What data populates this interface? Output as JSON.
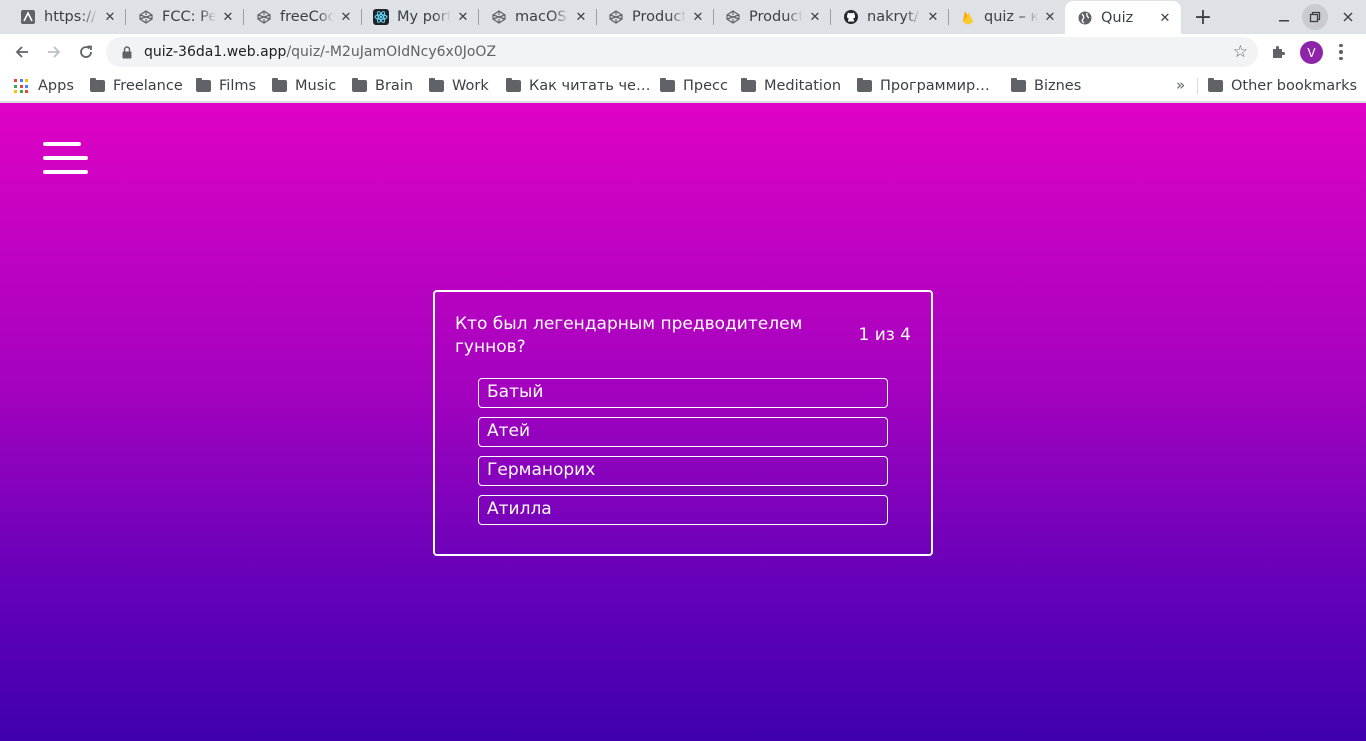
{
  "browser": {
    "tabs": [
      {
        "title": "https://",
        "icon": "generic-page-icon",
        "active": false
      },
      {
        "title": "FCC: Per",
        "icon": "codepen-icon",
        "active": false
      },
      {
        "title": "freeCoc",
        "icon": "codepen-icon",
        "active": false
      },
      {
        "title": "My port",
        "icon": "react-icon",
        "active": false
      },
      {
        "title": "macOS",
        "icon": "codepen-icon",
        "active": false
      },
      {
        "title": "Product",
        "icon": "codepen-icon",
        "active": false
      },
      {
        "title": "Product",
        "icon": "codepen-icon",
        "active": false
      },
      {
        "title": "nakryt/",
        "icon": "github-icon",
        "active": false
      },
      {
        "title": "quiz – ко",
        "icon": "firebase-icon",
        "active": false
      },
      {
        "title": "Quiz",
        "icon": "globe-icon",
        "active": true
      }
    ],
    "address": {
      "host": "quiz-36da1.web.app",
      "path": "/quiz/-M2uJamOIdNcy6x0JoOZ"
    },
    "profile_initial": "V",
    "bookmarks": [
      {
        "label": "Apps",
        "type": "apps"
      },
      {
        "label": "Freelance",
        "type": "folder"
      },
      {
        "label": "Films",
        "type": "folder"
      },
      {
        "label": "Music",
        "type": "folder"
      },
      {
        "label": "Brain",
        "type": "folder"
      },
      {
        "label": "Work",
        "type": "folder"
      },
      {
        "label": "Как читать че…",
        "type": "folder"
      },
      {
        "label": "Пресс",
        "type": "folder"
      },
      {
        "label": "Meditation",
        "type": "folder"
      },
      {
        "label": "Программир…",
        "type": "folder"
      },
      {
        "label": "Biznes",
        "type": "folder"
      }
    ],
    "bookmarks_overflow": "»",
    "other_bookmarks": "Other bookmarks"
  },
  "quiz": {
    "question": "Кто был легендарным предводителем гуннов?",
    "counter": "1 из 4",
    "answers": [
      "Батый",
      "Атей",
      "Германорих",
      "Атилла"
    ]
  },
  "colors": {
    "gradient_top": "#df02c4",
    "gradient_bottom": "#3f00ad",
    "card_border": "#ffffff",
    "text": "#ffffff"
  }
}
